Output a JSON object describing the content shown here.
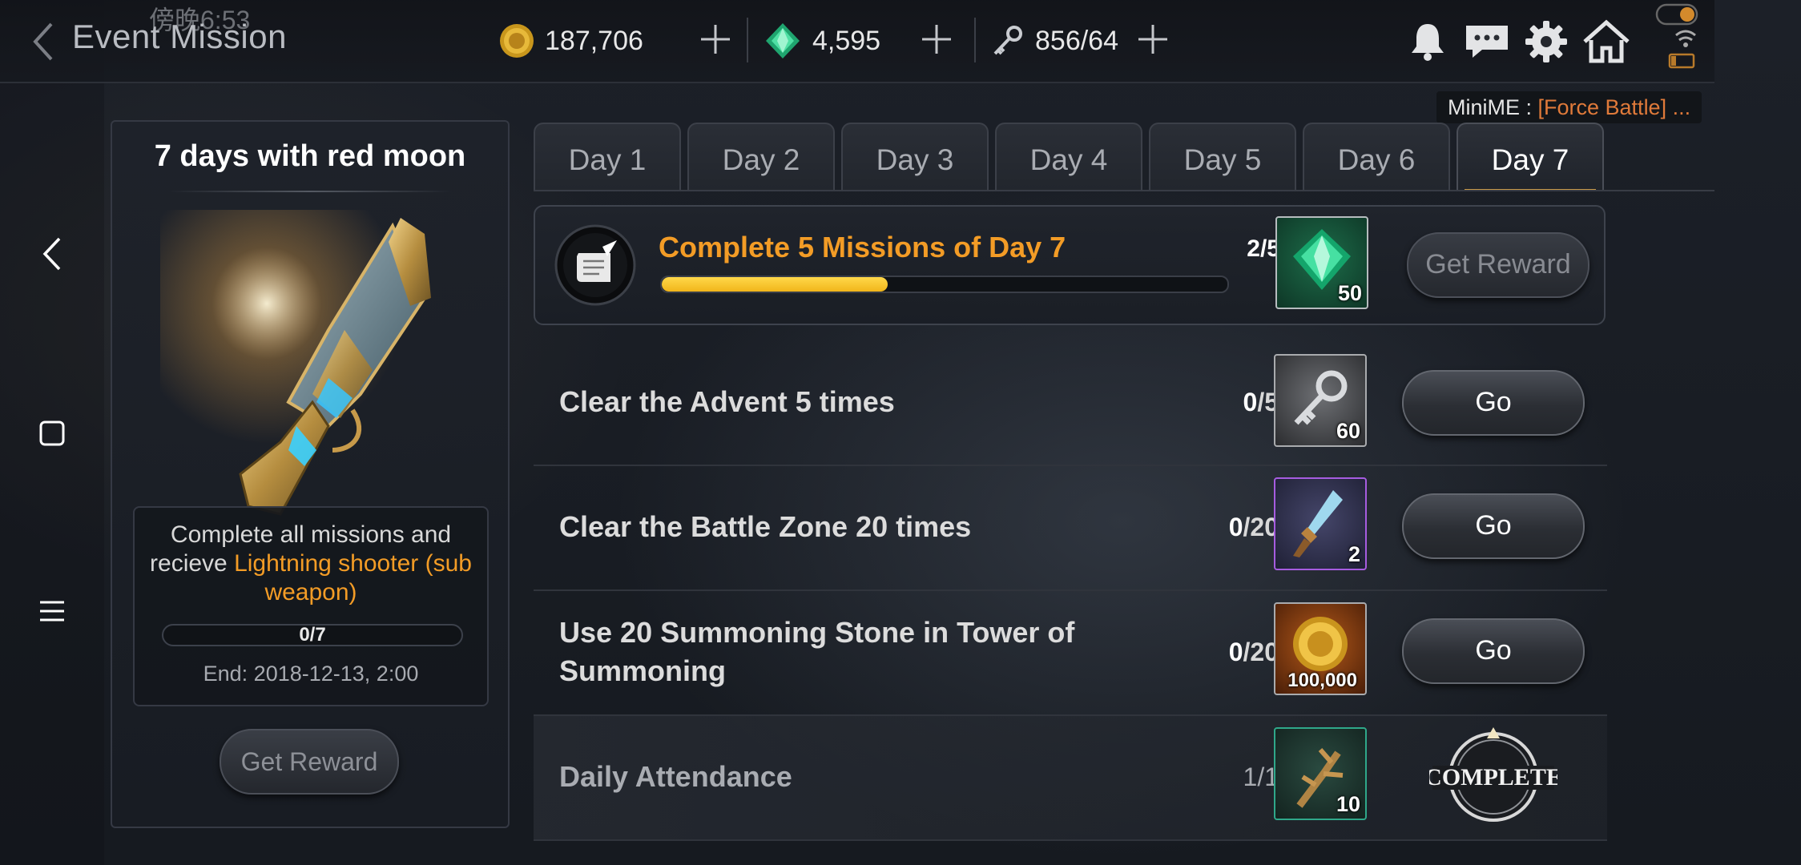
{
  "status": {
    "time": "傍晚6:53"
  },
  "header": {
    "title": "Event Mission"
  },
  "currencies": [
    {
      "name": "gold",
      "value": "187,706"
    },
    {
      "name": "gem",
      "value": "4,595"
    },
    {
      "name": "key",
      "value": "856/64"
    }
  ],
  "minime": {
    "prefix": "MiniME : ",
    "text": "[Force Battle] ..."
  },
  "event": {
    "title": "7 days with red moon",
    "desc_prefix": "Complete all missions and recieve ",
    "desc_highlight": "Lightning shooter (sub weapon)",
    "progress_text": "0/7",
    "progress": 0,
    "end": "End: 2018-12-13, 2:00",
    "button": "Get Reward"
  },
  "tabs": [
    "Day 1",
    "Day 2",
    "Day 3",
    "Day 4",
    "Day 5",
    "Day 6",
    "Day 7"
  ],
  "active_tab": "Day 7",
  "main_mission": {
    "title": "Complete 5 Missions of Day 7",
    "current": "2",
    "total": "/5",
    "progress": 0.4,
    "reward_qty": "50",
    "reward_icon": "gem-icon",
    "button": "Get Reward"
  },
  "missions": [
    {
      "name": "Clear the Advent 5 times",
      "current": "0",
      "total": "/5",
      "reward_qty": "60",
      "reward_icon": "key-icon",
      "button": "Go"
    },
    {
      "name": "Clear the Battle Zone 20 times",
      "current": "0",
      "total": "/20",
      "reward_qty": "2",
      "reward_icon": "dagger-icon",
      "button": "Go"
    },
    {
      "name": "Use 20 Summoning Stone in Tower of Summoning",
      "current": "0",
      "total": "/20",
      "reward_qty": "100,000",
      "reward_icon": "gold-coin-icon",
      "button": "Go"
    },
    {
      "name": "Daily Attendance",
      "current": "1",
      "total": "/1",
      "reward_qty": "10",
      "reward_icon": "branch-icon",
      "status": "COMPLETE"
    }
  ],
  "colors": {
    "accent": "#f39c26",
    "progress": "#f1b51a",
    "active_tab_line": "#c99a4a"
  }
}
